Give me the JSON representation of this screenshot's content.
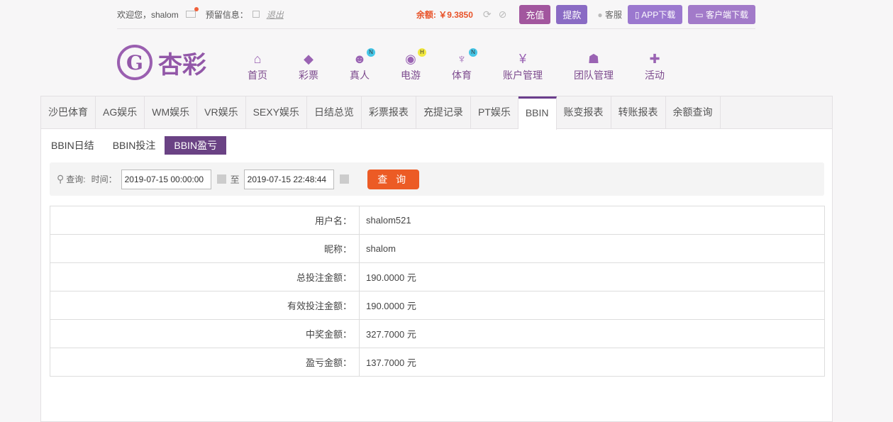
{
  "topbar": {
    "welcome": "欢迎您，shalom",
    "reserved_info": "预留信息：",
    "logout": "退出",
    "balance": "余额: ￥9.3850",
    "recharge": "充值",
    "withdraw": "提款",
    "service": "客服",
    "app_download": "APP下载",
    "client_download": "客户端下载"
  },
  "logo": {
    "text": "杏彩"
  },
  "nav": [
    {
      "label": "首页",
      "icon": "home-icon"
    },
    {
      "label": "彩票",
      "icon": "ticket-icon"
    },
    {
      "label": "真人",
      "icon": "person-icon",
      "badge": "N"
    },
    {
      "label": "电游",
      "icon": "gamepad-icon",
      "badge": "H"
    },
    {
      "label": "体育",
      "icon": "trophy-icon",
      "badge": "N"
    },
    {
      "label": "账户管理",
      "icon": "yen-icon"
    },
    {
      "label": "团队管理",
      "icon": "team-icon"
    },
    {
      "label": "活动",
      "icon": "gift-icon"
    }
  ],
  "tabs": [
    "沙巴体育",
    "AG娱乐",
    "WM娱乐",
    "VR娱乐",
    "SEXY娱乐",
    "日结总览",
    "彩票报表",
    "充提记录",
    "PT娱乐",
    "BBIN",
    "账变报表",
    "转账报表",
    "余额查询"
  ],
  "active_tab": "BBIN",
  "subtabs": [
    "BBIN日结",
    "BBIN投注",
    "BBIN盈亏"
  ],
  "active_subtab": "BBIN盈亏",
  "query": {
    "label": "查询:",
    "time_label": "时间：",
    "start": "2019-07-15 00:00:00",
    "to": "至",
    "end": "2019-07-15 22:48:44",
    "button": "查 询"
  },
  "rows": [
    {
      "label": "用户名：",
      "value": "shalom521"
    },
    {
      "label": "昵称：",
      "value": "shalom"
    },
    {
      "label": "总投注金额：",
      "value": "190.0000 元"
    },
    {
      "label": "有效投注金额：",
      "value": "190.0000 元"
    },
    {
      "label": "中奖金额：",
      "value": "327.7000 元"
    },
    {
      "label": "盈亏金额：",
      "value": "137.7000 元"
    }
  ],
  "colors": {
    "accent": "#6a4284",
    "query_button": "#ec5b25",
    "balance": "#e8532a"
  }
}
